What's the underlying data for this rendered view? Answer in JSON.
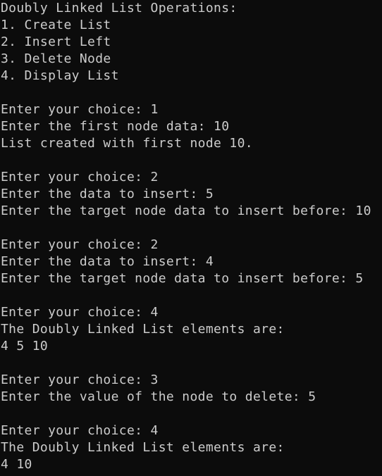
{
  "terminal": {
    "lines": [
      "Doubly Linked List Operations:",
      "1. Create List",
      "2. Insert Left",
      "3. Delete Node",
      "4. Display List",
      "",
      "Enter your choice: 1",
      "Enter the first node data: 10",
      "List created with first node 10.",
      "",
      "Enter your choice: 2",
      "Enter the data to insert: 5",
      "Enter the target node data to insert before: 10",
      "",
      "Enter your choice: 2",
      "Enter the data to insert: 4",
      "Enter the target node data to insert before: 5",
      "",
      "Enter your choice: 4",
      "The Doubly Linked List elements are:",
      "4 5 10",
      "",
      "Enter your choice: 3",
      "Enter the value of the node to delete: 5",
      "",
      "Enter your choice: 4",
      "The Doubly Linked List elements are:",
      "4 10"
    ]
  },
  "colors": {
    "background": "#0c0c0c",
    "text": "#cccccc"
  }
}
